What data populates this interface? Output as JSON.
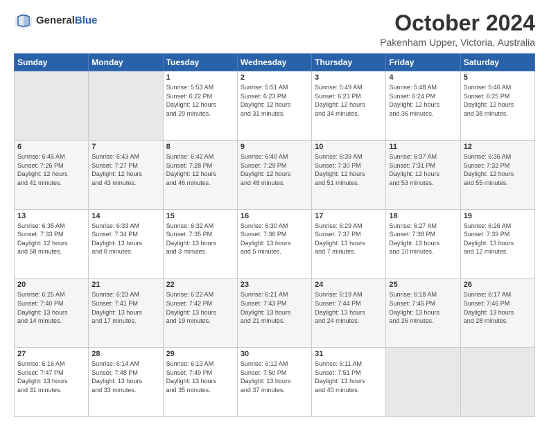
{
  "logo": {
    "text1": "General",
    "text2": "Blue"
  },
  "title": "October 2024",
  "subtitle": "Pakenham Upper, Victoria, Australia",
  "days_of_week": [
    "Sunday",
    "Monday",
    "Tuesday",
    "Wednesday",
    "Thursday",
    "Friday",
    "Saturday"
  ],
  "weeks": [
    [
      {
        "day": "",
        "content": ""
      },
      {
        "day": "",
        "content": ""
      },
      {
        "day": "1",
        "content": "Sunrise: 5:53 AM\nSunset: 6:22 PM\nDaylight: 12 hours\nand 29 minutes."
      },
      {
        "day": "2",
        "content": "Sunrise: 5:51 AM\nSunset: 6:23 PM\nDaylight: 12 hours\nand 31 minutes."
      },
      {
        "day": "3",
        "content": "Sunrise: 5:49 AM\nSunset: 6:23 PM\nDaylight: 12 hours\nand 34 minutes."
      },
      {
        "day": "4",
        "content": "Sunrise: 5:48 AM\nSunset: 6:24 PM\nDaylight: 12 hours\nand 36 minutes."
      },
      {
        "day": "5",
        "content": "Sunrise: 5:46 AM\nSunset: 6:25 PM\nDaylight: 12 hours\nand 38 minutes."
      }
    ],
    [
      {
        "day": "6",
        "content": "Sunrise: 6:45 AM\nSunset: 7:26 PM\nDaylight: 12 hours\nand 41 minutes."
      },
      {
        "day": "7",
        "content": "Sunrise: 6:43 AM\nSunset: 7:27 PM\nDaylight: 12 hours\nand 43 minutes."
      },
      {
        "day": "8",
        "content": "Sunrise: 6:42 AM\nSunset: 7:28 PM\nDaylight: 12 hours\nand 46 minutes."
      },
      {
        "day": "9",
        "content": "Sunrise: 6:40 AM\nSunset: 7:29 PM\nDaylight: 12 hours\nand 48 minutes."
      },
      {
        "day": "10",
        "content": "Sunrise: 6:39 AM\nSunset: 7:30 PM\nDaylight: 12 hours\nand 51 minutes."
      },
      {
        "day": "11",
        "content": "Sunrise: 6:37 AM\nSunset: 7:31 PM\nDaylight: 12 hours\nand 53 minutes."
      },
      {
        "day": "12",
        "content": "Sunrise: 6:36 AM\nSunset: 7:32 PM\nDaylight: 12 hours\nand 55 minutes."
      }
    ],
    [
      {
        "day": "13",
        "content": "Sunrise: 6:35 AM\nSunset: 7:33 PM\nDaylight: 12 hours\nand 58 minutes."
      },
      {
        "day": "14",
        "content": "Sunrise: 6:33 AM\nSunset: 7:34 PM\nDaylight: 13 hours\nand 0 minutes."
      },
      {
        "day": "15",
        "content": "Sunrise: 6:32 AM\nSunset: 7:35 PM\nDaylight: 13 hours\nand 3 minutes."
      },
      {
        "day": "16",
        "content": "Sunrise: 6:30 AM\nSunset: 7:36 PM\nDaylight: 13 hours\nand 5 minutes."
      },
      {
        "day": "17",
        "content": "Sunrise: 6:29 AM\nSunset: 7:37 PM\nDaylight: 13 hours\nand 7 minutes."
      },
      {
        "day": "18",
        "content": "Sunrise: 6:27 AM\nSunset: 7:38 PM\nDaylight: 13 hours\nand 10 minutes."
      },
      {
        "day": "19",
        "content": "Sunrise: 6:26 AM\nSunset: 7:39 PM\nDaylight: 13 hours\nand 12 minutes."
      }
    ],
    [
      {
        "day": "20",
        "content": "Sunrise: 6:25 AM\nSunset: 7:40 PM\nDaylight: 13 hours\nand 14 minutes."
      },
      {
        "day": "21",
        "content": "Sunrise: 6:23 AM\nSunset: 7:41 PM\nDaylight: 13 hours\nand 17 minutes."
      },
      {
        "day": "22",
        "content": "Sunrise: 6:22 AM\nSunset: 7:42 PM\nDaylight: 13 hours\nand 19 minutes."
      },
      {
        "day": "23",
        "content": "Sunrise: 6:21 AM\nSunset: 7:43 PM\nDaylight: 13 hours\nand 21 minutes."
      },
      {
        "day": "24",
        "content": "Sunrise: 6:19 AM\nSunset: 7:44 PM\nDaylight: 13 hours\nand 24 minutes."
      },
      {
        "day": "25",
        "content": "Sunrise: 6:18 AM\nSunset: 7:45 PM\nDaylight: 13 hours\nand 26 minutes."
      },
      {
        "day": "26",
        "content": "Sunrise: 6:17 AM\nSunset: 7:46 PM\nDaylight: 13 hours\nand 28 minutes."
      }
    ],
    [
      {
        "day": "27",
        "content": "Sunrise: 6:16 AM\nSunset: 7:47 PM\nDaylight: 13 hours\nand 31 minutes."
      },
      {
        "day": "28",
        "content": "Sunrise: 6:14 AM\nSunset: 7:48 PM\nDaylight: 13 hours\nand 33 minutes."
      },
      {
        "day": "29",
        "content": "Sunrise: 6:13 AM\nSunset: 7:49 PM\nDaylight: 13 hours\nand 35 minutes."
      },
      {
        "day": "30",
        "content": "Sunrise: 6:12 AM\nSunset: 7:50 PM\nDaylight: 13 hours\nand 37 minutes."
      },
      {
        "day": "31",
        "content": "Sunrise: 6:11 AM\nSunset: 7:51 PM\nDaylight: 13 hours\nand 40 minutes."
      },
      {
        "day": "",
        "content": ""
      },
      {
        "day": "",
        "content": ""
      }
    ]
  ]
}
